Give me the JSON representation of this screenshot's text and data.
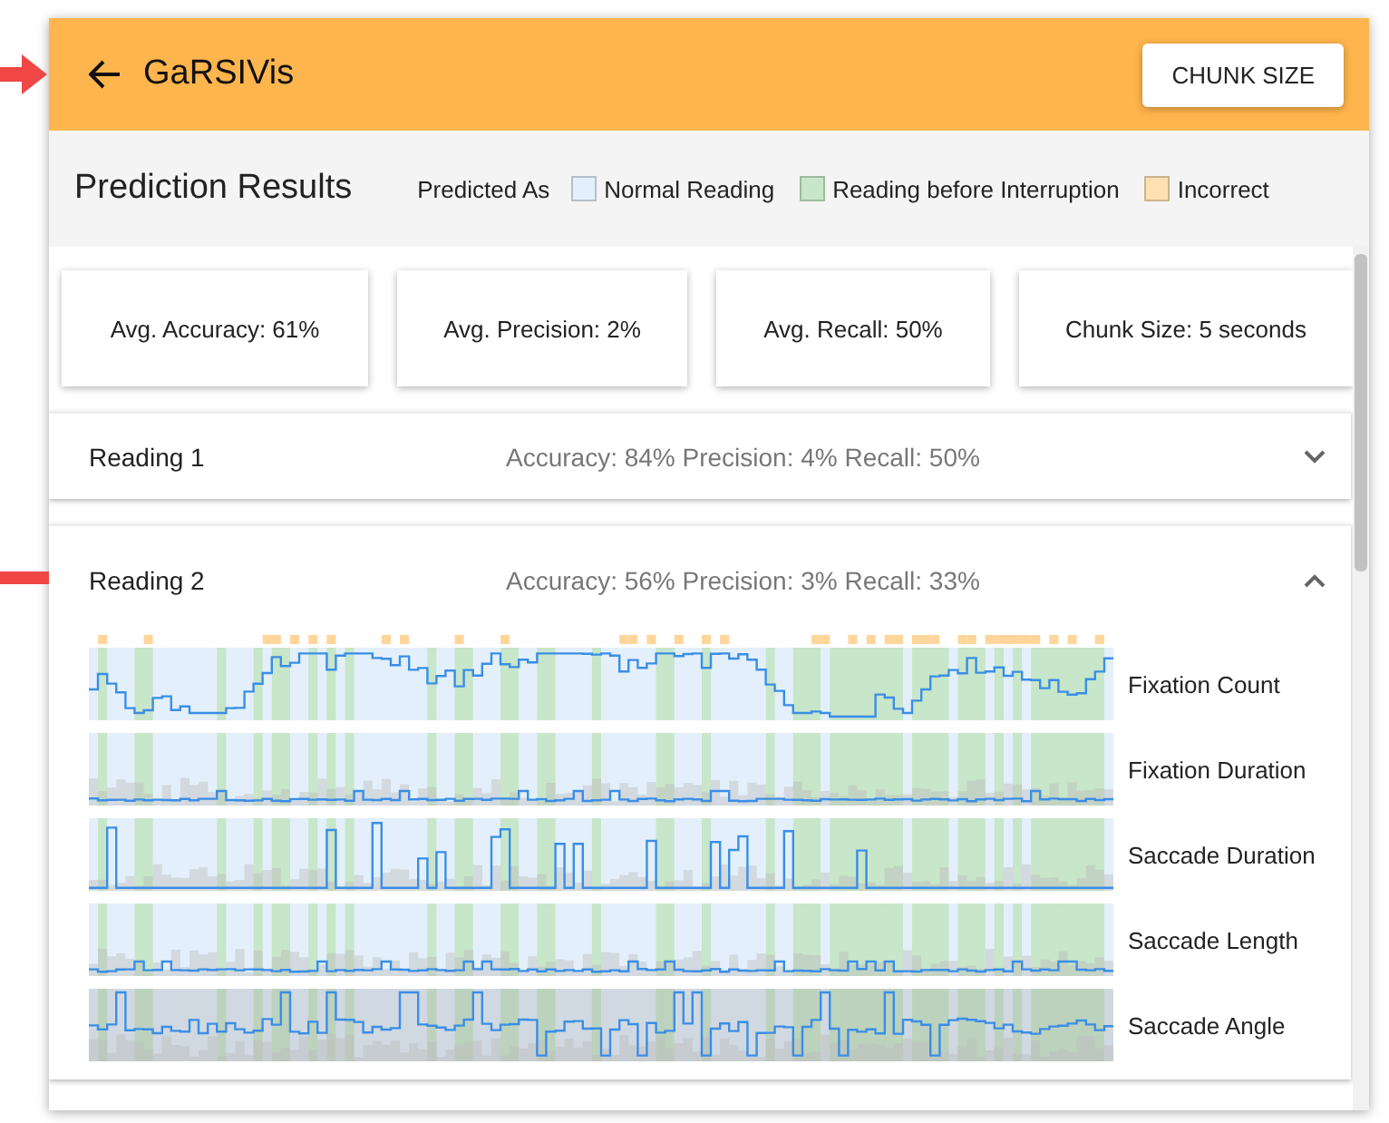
{
  "app_bar": {
    "title": "GaRSIVis",
    "button": "CHUNK SIZE"
  },
  "header": {
    "title": "Prediction Results",
    "legend_label": "Predicted As",
    "legend": [
      {
        "label": "Normal Reading",
        "color": "#e3f0fb"
      },
      {
        "label": "Reading before Interruption",
        "color": "#c8e6c9"
      },
      {
        "label": "Incorrect",
        "color": "#ffe0b2"
      }
    ]
  },
  "stats": [
    "Avg. Accuracy: 61%",
    "Avg. Precision: 2%",
    "Avg. Recall: 50%",
    "Chunk Size: 5 seconds"
  ],
  "readings": [
    {
      "title": "Reading 1",
      "metrics": "Accuracy: 84% Precision: 4% Recall: 50%",
      "expanded": false
    },
    {
      "title": "Reading 2",
      "metrics": "Accuracy: 56% Precision: 3% Recall: 33%",
      "expanded": true,
      "features": [
        {
          "label": "Fixation Count",
          "kind": "walk"
        },
        {
          "label": "Fixation Duration",
          "kind": "flat"
        },
        {
          "label": "Saccade Duration",
          "kind": "spikes"
        },
        {
          "label": "Saccade Length",
          "kind": "flat"
        },
        {
          "label": "Saccade Angle",
          "kind": "angle"
        }
      ]
    }
  ]
}
